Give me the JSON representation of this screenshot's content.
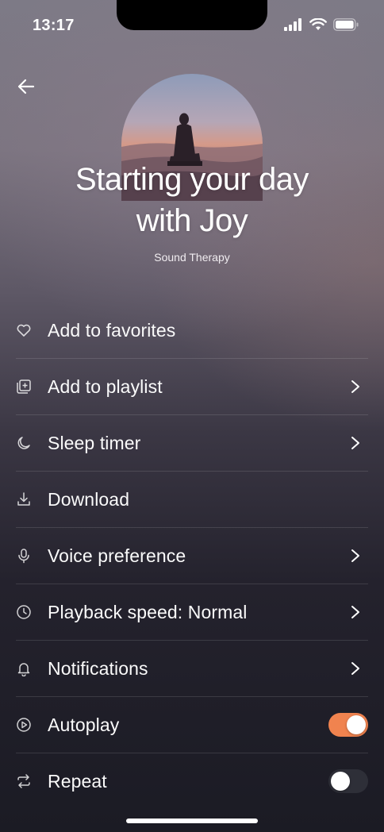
{
  "status_bar": {
    "time": "13:17"
  },
  "header": {
    "title_line1": "Starting your day",
    "title_line2": "with Joy",
    "subtitle": "Sound Therapy"
  },
  "menu": {
    "items": [
      {
        "label": "Add to favorites",
        "icon": "heart-icon"
      },
      {
        "label": "Add to playlist",
        "icon": "playlist-add-icon"
      },
      {
        "label": "Sleep timer",
        "icon": "moon-icon"
      },
      {
        "label": "Download",
        "icon": "download-icon"
      },
      {
        "label": "Voice preference",
        "icon": "microphone-icon"
      },
      {
        "label": "Playback speed: Normal",
        "icon": "clock-icon"
      },
      {
        "label": "Notifications",
        "icon": "bell-icon"
      },
      {
        "label": "Autoplay",
        "icon": "play-circle-icon",
        "toggle": true
      },
      {
        "label": "Repeat",
        "icon": "repeat-icon",
        "toggle": false
      }
    ]
  },
  "colors": {
    "accent": "#f0834f",
    "toggle_off": "#2e2f38"
  }
}
